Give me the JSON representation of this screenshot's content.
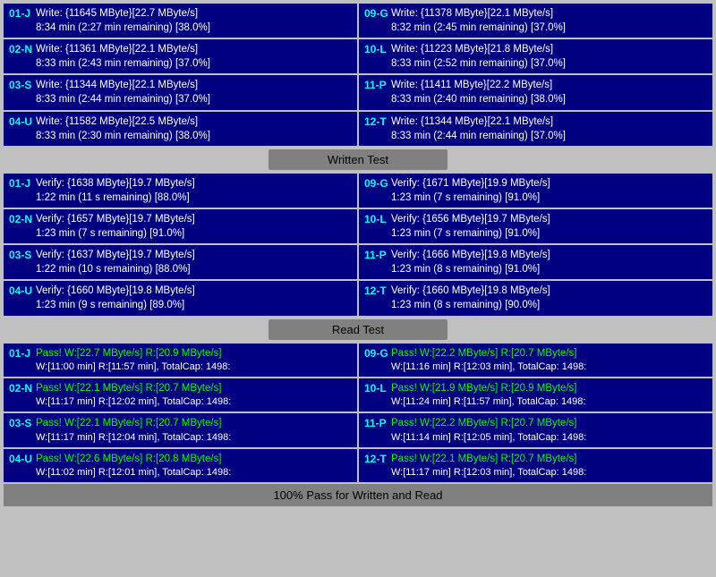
{
  "sections": {
    "write_test": {
      "header": "Written Test",
      "left_cards": [
        {
          "id": "01-J",
          "line1": "Write: {11645 MByte}[22.7 MByte/s]",
          "line2": "8:34 min (2:27 min remaining)  [38.0%]"
        },
        {
          "id": "02-N",
          "line1": "Write: {11361 MByte}[22.1 MByte/s]",
          "line2": "8:33 min (2:43 min remaining)  [37.0%]"
        },
        {
          "id": "03-S",
          "line1": "Write: {11344 MByte}[22.1 MByte/s]",
          "line2": "8:33 min (2:44 min remaining)  [37.0%]"
        },
        {
          "id": "04-U",
          "line1": "Write: {11582 MByte}[22.5 MByte/s]",
          "line2": "8:33 min (2:30 min remaining)  [38.0%]"
        }
      ],
      "right_cards": [
        {
          "id": "09-G",
          "line1": "Write: {11378 MByte}[22.1 MByte/s]",
          "line2": "8:32 min (2:45 min remaining)  [37.0%]"
        },
        {
          "id": "10-L",
          "line1": "Write: {11223 MByte}[21.8 MByte/s]",
          "line2": "8:33 min (2:52 min remaining)  [37.0%]"
        },
        {
          "id": "11-P",
          "line1": "Write: {11411 MByte}[22.2 MByte/s]",
          "line2": "8:33 min (2:40 min remaining)  [38.0%]"
        },
        {
          "id": "12-T",
          "line1": "Write: {11344 MByte}[22.1 MByte/s]",
          "line2": "8:33 min (2:44 min remaining)  [37.0%]"
        }
      ]
    },
    "verify_test": {
      "left_cards": [
        {
          "id": "01-J",
          "line1": "Verify: {1638 MByte}[19.7 MByte/s]",
          "line2": "1:22 min (11 s remaining)  [88.0%]"
        },
        {
          "id": "02-N",
          "line1": "Verify: {1657 MByte}[19.7 MByte/s]",
          "line2": "1:23 min (7 s remaining)  [91.0%]"
        },
        {
          "id": "03-S",
          "line1": "Verify: {1637 MByte}[19.7 MByte/s]",
          "line2": "1:22 min (10 s remaining)  [88.0%]"
        },
        {
          "id": "04-U",
          "line1": "Verify: {1660 MByte}[19.8 MByte/s]",
          "line2": "1:23 min (9 s remaining)  [89.0%]"
        }
      ],
      "right_cards": [
        {
          "id": "09-G",
          "line1": "Verify: {1671 MByte}[19.9 MByte/s]",
          "line2": "1:23 min (7 s remaining)  [91.0%]"
        },
        {
          "id": "10-L",
          "line1": "Verify: {1656 MByte}[19.7 MByte/s]",
          "line2": "1:23 min (7 s remaining)  [91.0%]"
        },
        {
          "id": "11-P",
          "line1": "Verify: {1666 MByte}[19.8 MByte/s]",
          "line2": "1:23 min (8 s remaining)  [91.0%]"
        },
        {
          "id": "12-T",
          "line1": "Verify: {1660 MByte}[19.8 MByte/s]",
          "line2": "1:23 min (8 s remaining)  [90.0%]"
        }
      ]
    },
    "read_test": {
      "header": "Read Test",
      "left_cards": [
        {
          "id": "01-J",
          "line1": "Pass! W:[22.7 MByte/s] R:[20.9 MByte/s]",
          "line2": "W:[11:00 min] R:[11:57 min], TotalCap: 1498:"
        },
        {
          "id": "02-N",
          "line1": "Pass! W:[22.1 MByte/s] R:[20.7 MByte/s]",
          "line2": "W:[11:17 min] R:[12:02 min], TotalCap: 1498:"
        },
        {
          "id": "03-S",
          "line1": "Pass! W:[22.1 MByte/s] R:[20.7 MByte/s]",
          "line2": "W:[11:17 min] R:[12:04 min], TotalCap: 1498:"
        },
        {
          "id": "04-U",
          "line1": "Pass! W:[22.6 MByte/s] R:[20.8 MByte/s]",
          "line2": "W:[11:02 min] R:[12:01 min], TotalCap: 1498:"
        }
      ],
      "right_cards": [
        {
          "id": "09-G",
          "line1": "Pass! W:[22.2 MByte/s] R:[20.7 MByte/s]",
          "line2": "W:[11:16 min] R:[12:03 min], TotalCap: 1498:"
        },
        {
          "id": "10-L",
          "line1": "Pass! W:[21.9 MByte/s] R:[20.9 MByte/s]",
          "line2": "W:[11:24 min] R:[11:57 min], TotalCap: 1498:"
        },
        {
          "id": "11-P",
          "line1": "Pass! W:[22.2 MByte/s] R:[20.7 MByte/s]",
          "line2": "W:[11:14 min] R:[12:05 min], TotalCap: 1498:"
        },
        {
          "id": "12-T",
          "line1": "Pass! W:[22.1 MByte/s] R:[20.7 MByte/s]",
          "line2": "W:[11:17 min] R:[12:03 min], TotalCap: 1498:"
        }
      ]
    }
  },
  "footer": "100% Pass for Written and Read"
}
